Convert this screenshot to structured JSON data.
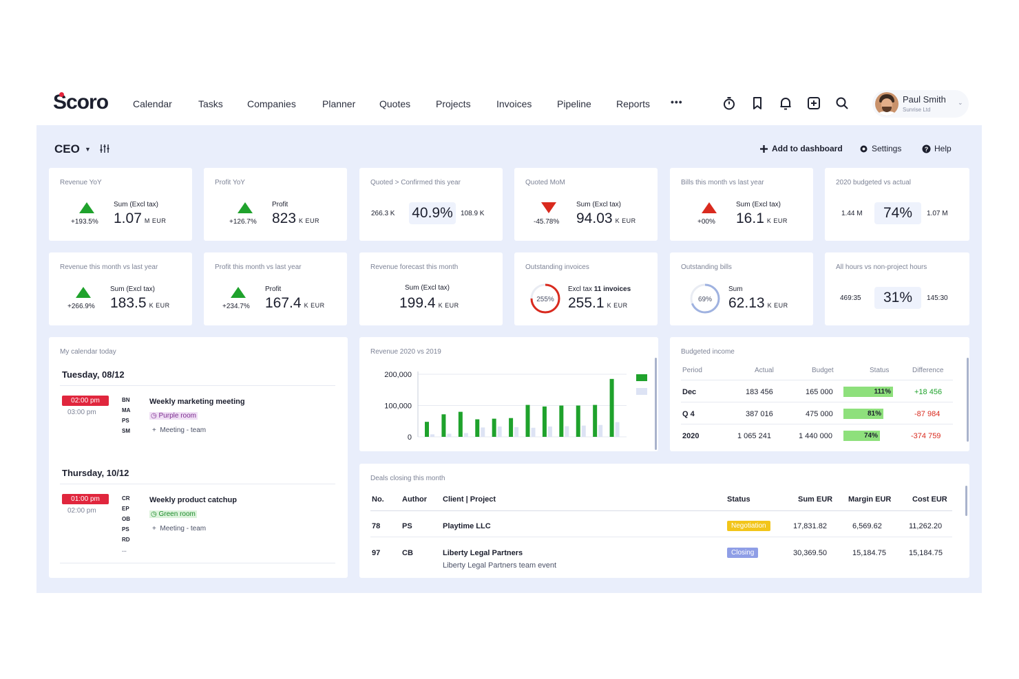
{
  "app": {
    "logo": "Scoro",
    "nav": [
      "Calendar",
      "Tasks",
      "Companies",
      "Planner",
      "Quotes",
      "Projects",
      "Invoices",
      "Pipeline",
      "Reports"
    ],
    "more": "•••",
    "icons": [
      "timer-icon",
      "bookmark-icon",
      "bell-icon",
      "add-box-icon",
      "search-icon"
    ],
    "user": {
      "name": "Paul Smith",
      "company": "Sunrise Ltd"
    }
  },
  "dashboard": {
    "title": "CEO",
    "add_label": "Add to dashboard",
    "settings_label": "Settings",
    "help_label": "Help"
  },
  "kpis": [
    {
      "title": "Revenue YoY",
      "trend": "up",
      "pct": "+193.5%",
      "label": "Sum (Excl tax)",
      "value": "1.07",
      "unit": "M EUR"
    },
    {
      "title": "Profit YoY",
      "trend": "up",
      "pct": "+126.7%",
      "label": "Profit",
      "value": "823",
      "unit": "K EUR"
    },
    {
      "title": "Quoted > Confirmed this year",
      "left": "266.3 K",
      "center": "40.9%",
      "right": "108.9 K"
    },
    {
      "title": "Quoted MoM",
      "trend": "down",
      "pct": "-45.78%",
      "label": "Sum (Excl tax)",
      "value": "94.03",
      "unit": "K EUR"
    },
    {
      "title": "Bills this month vs last year",
      "trend": "up-red",
      "pct": "+00%",
      "label": "Sum (Excl tax)",
      "value": "16.1",
      "unit": "K EUR"
    },
    {
      "title": "2020 budgeted vs actual",
      "left": "1.44 M",
      "center": "74%",
      "right": "1.07 M"
    },
    {
      "title": "Revenue this month vs last year",
      "trend": "up",
      "pct": "+266.9%",
      "label": "Sum (Excl tax)",
      "value": "183.5",
      "unit": "K EUR"
    },
    {
      "title": "Profit this month vs last year",
      "trend": "up",
      "pct": "+234.7%",
      "label": "Profit",
      "value": "167.4",
      "unit": "K EUR"
    },
    {
      "title": "Revenue forecast this month",
      "label": "Sum (Excl tax)",
      "value": "199.4",
      "unit": "K EUR"
    },
    {
      "title": "Outstanding invoices",
      "ring": "255%",
      "ring_level": 0.75,
      "ring_color": "#d92a1e",
      "label": "Excl tax",
      "label_bold": "11 invoices",
      "value": "255.1",
      "unit": "K EUR"
    },
    {
      "title": "Outstanding bills",
      "ring": "69%",
      "ring_level": 0.69,
      "ring_color": "#9fb2e0",
      "label": "Sum",
      "value": "62.13",
      "unit": "K EUR"
    },
    {
      "title": "All hours vs non-project hours",
      "left": "469:35",
      "center": "31%",
      "right": "145:30"
    }
  ],
  "calendar": {
    "title": "My calendar today",
    "days": [
      {
        "date": "Tuesday, 08/12",
        "start": "02:00 pm",
        "end": "03:00 pm",
        "attendees": [
          "BN",
          "MA",
          "PS",
          "SM"
        ],
        "event": "Weekly marketing meeting",
        "room": "Purple room",
        "room_color": "#7b2c8f",
        "room_bg": "#f0dff5",
        "type": "Meeting - team"
      },
      {
        "date": "Thursday, 10/12",
        "start": "01:00 pm",
        "end": "02:00 pm",
        "attendees": [
          "CR",
          "EP",
          "OB",
          "PS",
          "RD",
          "..."
        ],
        "event": "Weekly product catchup",
        "room": "Green room",
        "room_color": "#1a8a2a",
        "room_bg": "#ddf3dc",
        "type": "Meeting - team"
      }
    ]
  },
  "chart_data": {
    "type": "bar",
    "title": "Revenue 2020 vs 2019",
    "yticks": [
      "200,000",
      "100,000",
      "0"
    ],
    "ylim": [
      0,
      200000
    ],
    "legend_position": "top-right",
    "series": [
      {
        "values": [
          48000,
          72000,
          80000,
          56000,
          58000,
          60000,
          102000,
          97000,
          100000,
          100000,
          102000,
          185000
        ],
        "color": "#1fa22c"
      },
      {
        "values": [
          8000,
          10000,
          12000,
          30000,
          33000,
          31000,
          29000,
          33000,
          34000,
          36000,
          38000,
          47000
        ],
        "color": "#dde3f4"
      }
    ]
  },
  "budget": {
    "title": "Budgeted income",
    "headers": [
      "Period",
      "Actual",
      "Budget",
      "Status",
      "Difference"
    ],
    "rows": [
      {
        "period": "Dec",
        "actual": "183 456",
        "budget": "165 000",
        "status": "111%",
        "fill": 1.0,
        "diff": "+18 456",
        "diff_color": "#1fa22c"
      },
      {
        "period": "Q 4",
        "actual": "387 016",
        "budget": "475 000",
        "status": "81%",
        "fill": 0.81,
        "diff": "-87 984",
        "diff_color": "#d92a1e"
      },
      {
        "period": "2020",
        "actual": "1 065 241",
        "budget": "1 440 000",
        "status": "74%",
        "fill": 0.74,
        "diff": "-374 759",
        "diff_color": "#d92a1e"
      }
    ]
  },
  "deals": {
    "title": "Deals closing this month",
    "headers": [
      "No.",
      "Author",
      "Client | Project",
      "Status",
      "Sum EUR",
      "Margin EUR",
      "Cost EUR"
    ],
    "rows": [
      {
        "no": "78",
        "author": "PS",
        "client": "Playtime LLC",
        "project": "",
        "status": "Negotiation",
        "status_color": "#f2c51a",
        "sum": "17,831.82",
        "margin": "6,569.62",
        "cost": "11,262.20"
      },
      {
        "no": "97",
        "author": "CB",
        "client": "Liberty Legal Partners",
        "project": "Liberty Legal Partners team event",
        "status": "Closing",
        "status_color": "#8f9ee6",
        "sum": "30,369.50",
        "margin": "15,184.75",
        "cost": "15,184.75"
      }
    ]
  }
}
